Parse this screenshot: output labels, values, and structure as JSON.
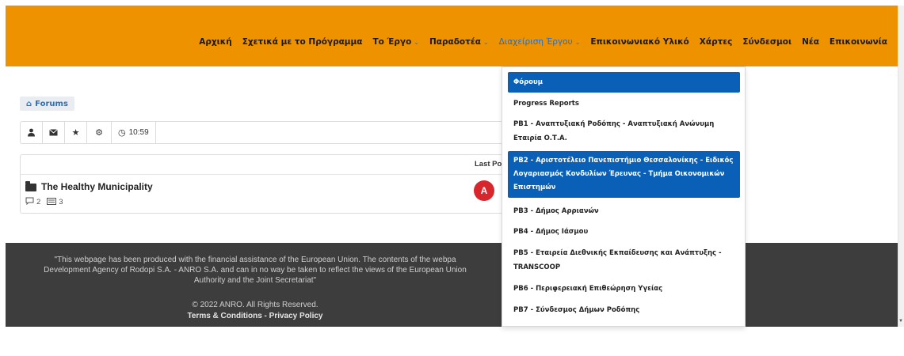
{
  "nav": {
    "items": [
      {
        "label": "Αρχική",
        "caret": false,
        "active": false
      },
      {
        "label": "Σχετικά με το Πρόγραμμα",
        "caret": false,
        "active": false
      },
      {
        "label": "Το Έργο",
        "caret": true,
        "active": false
      },
      {
        "label": "Παραδοτέα",
        "caret": true,
        "active": false
      },
      {
        "label": "Διαχείριση Έργου",
        "caret": true,
        "active": true
      },
      {
        "label": "Επικοινωνιακό Υλικό",
        "caret": false,
        "active": false
      },
      {
        "label": "Χάρτες",
        "caret": false,
        "active": false
      },
      {
        "label": "Σύνδεσμοι",
        "caret": false,
        "active": false
      },
      {
        "label": "Νέα",
        "caret": false,
        "active": false
      },
      {
        "label": "Επικοινωνία",
        "caret": false,
        "active": false
      }
    ]
  },
  "breadcrumb": {
    "label": "Forums"
  },
  "toolbar": {
    "time": "10:59"
  },
  "forum": {
    "last_post_header": "Last Pos",
    "title": "The Healthy Municipality",
    "topics_count": "2",
    "posts_count": "3",
    "avatar_letter": "A"
  },
  "footer": {
    "disclaimer_line1": "\"This webpage has been produced with the financial assistance of the European Union. The contents of the webpa",
    "disclaimer_line2": "Development Agency of Rodopi S.A. - ANRO S.A. and can in no way be taken to reflect the views of the European Union",
    "disclaimer_line3": "Authority and the Joint Secretariat\"",
    "copyright": "© 2022 ANRO. All Rights Reserved.",
    "terms": "Terms & Conditions",
    "separator": " - ",
    "privacy": "Privacy Policy"
  },
  "dropdown": {
    "items": [
      {
        "label": "Φόρουμ",
        "highlight": true
      },
      {
        "label": "Progress Reports",
        "highlight": false
      },
      {
        "label": "PB1 - Αναπτυξιακή Ροδόπης - Αναπτυξιακή Ανώνυμη Εταιρία Ο.Τ.Α.",
        "highlight": false
      },
      {
        "label": "PB2 - Αριστοτέλειο Πανεπιστήμιο Θεσσαλονίκης - Ειδικός Λογαριασμός Κονδυλίων Έρευνας - Τμήμα Οικονομικών Επιστημών",
        "highlight": true
      },
      {
        "label": "PB3 - Δήμος Αρριανών",
        "highlight": false
      },
      {
        "label": "PB4 - Δήμος Ιάσμου",
        "highlight": false
      },
      {
        "label": "PB5 - Εταιρεία Διεθνικής Εκπαίδευσης και Ανάπτυξης - TRANSCOOP",
        "highlight": false
      },
      {
        "label": "PB6 - Περιφερειακή Επιθεώρηση Υγείας",
        "highlight": false
      },
      {
        "label": "PB7 - Σύνδεσμος Δήμων Ροδόπης",
        "highlight": false
      }
    ]
  },
  "colors": {
    "header": "#ee9200",
    "accent": "#0a60b6",
    "footer": "#3d3d3d",
    "avatar": "#d8262d"
  }
}
